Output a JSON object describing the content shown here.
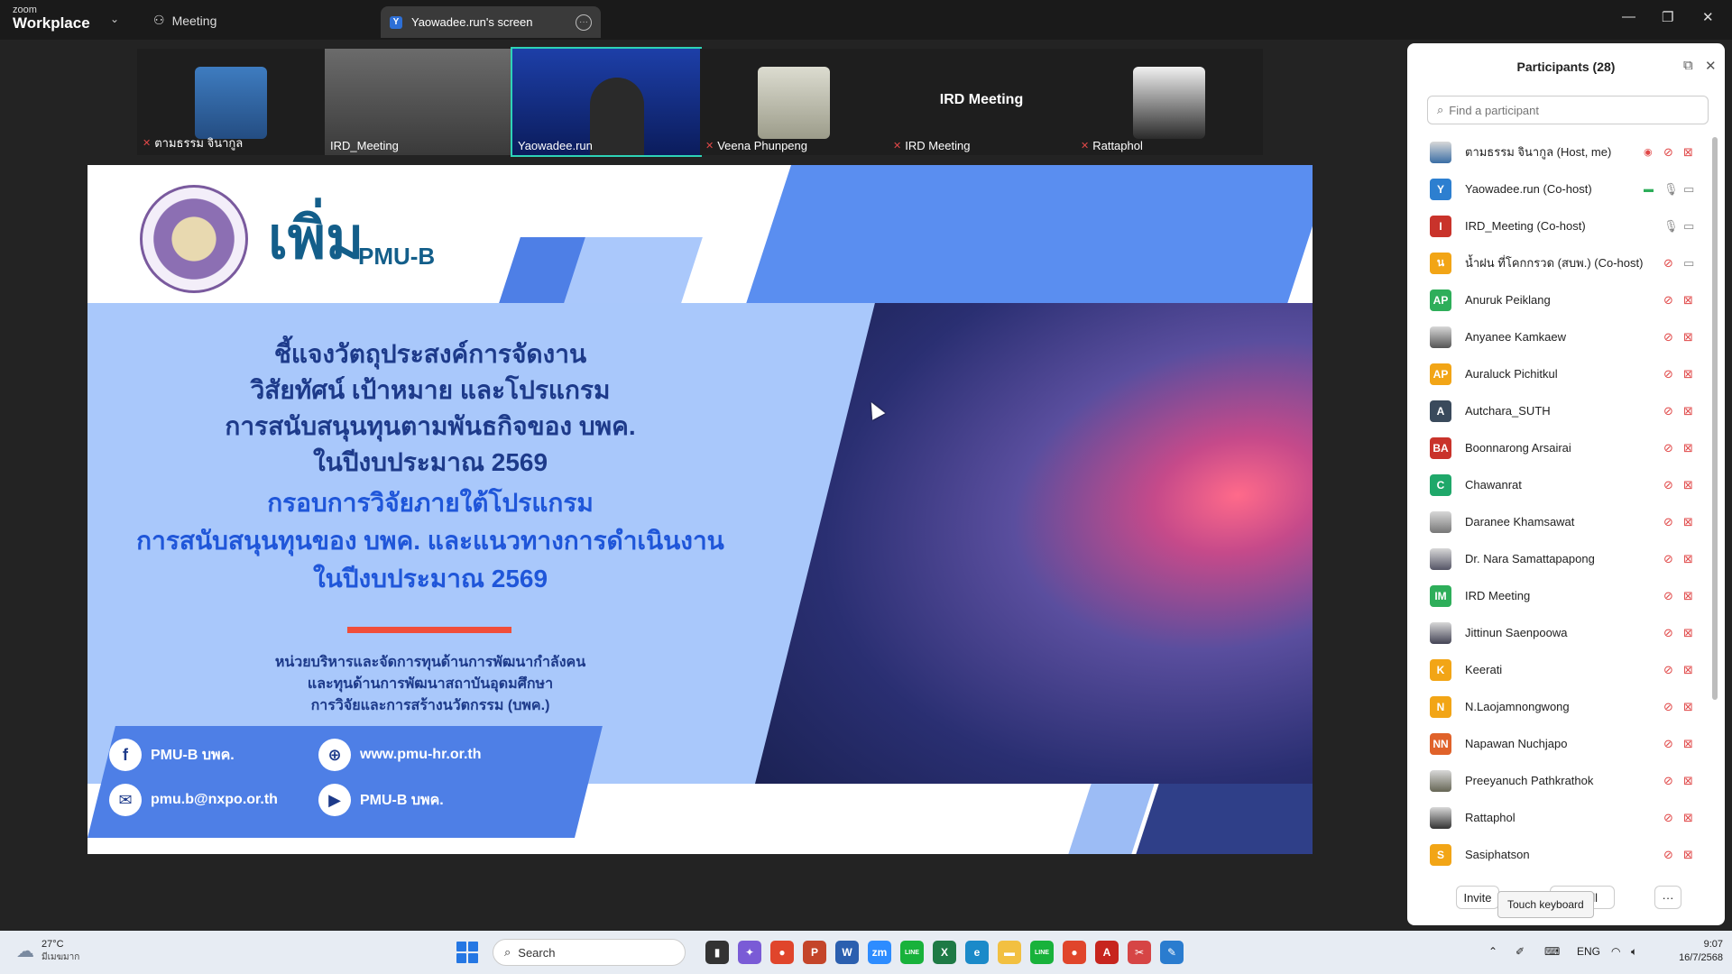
{
  "titlebar": {
    "brand_small": "zoom",
    "brand_big": "Workplace",
    "meeting_label": "Meeting",
    "tab_label": "Yaowadee.run's screen",
    "tab_icon_letter": "Y"
  },
  "thumbnails": [
    {
      "name": "ตามธรรม จินากูล",
      "muted": true
    },
    {
      "name": "IRD_Meeting",
      "muted": false
    },
    {
      "name": "Yaowadee.run",
      "muted": false
    },
    {
      "name": "Veena Phunpeng",
      "muted": true
    },
    {
      "name": "IRD Meeting",
      "muted": true,
      "tile_text": "IRD Meeting"
    },
    {
      "name": "Rattaphol",
      "muted": true
    }
  ],
  "slide": {
    "logo_text": "เพิ่ม",
    "logo_sub": "PMU-B",
    "title_lines_dark": [
      "ชี้แจงวัตถุประสงค์การจัดงาน",
      "วิสัยทัศน์ เป้าหมาย และโปรแกรม",
      "การสนับสนุนทุนตามพันธกิจของ บพค.",
      "ในปีงบประมาณ 2569"
    ],
    "title_lines_blue": [
      "กรอบการวิจัยภายใต้โปรแกรม",
      "การสนับสนุนทุนของ บพค. และแนวทางการดำเนินงาน",
      "ในปีงบประมาณ 2569"
    ],
    "org_lines": [
      "หน่วยบริหารและจัดการทุนด้านการพัฒนากำลังคน",
      "และทุนด้านการพัฒนาสถาบันอุดมศึกษา",
      "การวิจัยและการสร้างนวัตกรรม (บพค.)"
    ],
    "contacts": {
      "facebook": "PMU-B บพค.",
      "website": "www.pmu-hr.or.th",
      "email": "pmu.b@nxpo.or.th",
      "youtube": "PMU-B บพค."
    }
  },
  "participants": {
    "title": "Participants (28)",
    "search_placeholder": "Find a participant",
    "list": [
      {
        "name": "ตามธรรม จินากูล (Host, me)",
        "initials": "",
        "color": "#3a6ea5",
        "photo": true,
        "mic": "off",
        "cam": "off",
        "extra": "rec"
      },
      {
        "name": "Yaowadee.run (Co-host)",
        "initials": "Y",
        "color": "#2d7fd0",
        "mic": "on",
        "cam": "on",
        "extra": "share"
      },
      {
        "name": "IRD_Meeting (Co-host)",
        "initials": "I",
        "color": "#c9332b",
        "mic": "on",
        "cam": "on"
      },
      {
        "name": "น้ำฝน ที่โคกกรวด (สบพ.) (Co-host)",
        "initials": "น",
        "color": "#f2a516",
        "mic": "off",
        "cam": "on"
      },
      {
        "name": "Anuruk Peiklang",
        "initials": "AP",
        "color": "#2eae5a",
        "mic": "off",
        "cam": "off"
      },
      {
        "name": "Anyanee Kamkaew",
        "initials": "",
        "color": "#555",
        "photo": true,
        "mic": "off",
        "cam": "off"
      },
      {
        "name": "Auraluck Pichitkul",
        "initials": "AP",
        "color": "#f2a516",
        "mic": "off",
        "cam": "off"
      },
      {
        "name": "Autchara_SUTH",
        "initials": "A",
        "color": "#3a4a5c",
        "mic": "off",
        "cam": "off"
      },
      {
        "name": "Boonnarong Arsairai",
        "initials": "BA",
        "color": "#c9332b",
        "mic": "off",
        "cam": "off"
      },
      {
        "name": "Chawanrat",
        "initials": "C",
        "color": "#1fa86a",
        "mic": "off",
        "cam": "off"
      },
      {
        "name": "Daranee Khamsawat",
        "initials": "",
        "color": "#777",
        "photo": true,
        "mic": "off",
        "cam": "off"
      },
      {
        "name": "Dr. Nara Samattapapong",
        "initials": "",
        "color": "#556",
        "photo": true,
        "mic": "off",
        "cam": "off"
      },
      {
        "name": "IRD Meeting",
        "initials": "IM",
        "color": "#2eae5a",
        "mic": "off",
        "cam": "off"
      },
      {
        "name": "Jittinun Saenpoowa",
        "initials": "",
        "color": "#445",
        "photo": true,
        "mic": "off",
        "cam": "off"
      },
      {
        "name": "Keerati",
        "initials": "K",
        "color": "#f2a516",
        "mic": "off",
        "cam": "off"
      },
      {
        "name": "N.Laojamnongwong",
        "initials": "N",
        "color": "#f2a516",
        "mic": "off",
        "cam": "off"
      },
      {
        "name": "Napawan Nuchjapo",
        "initials": "NN",
        "color": "#e0622a",
        "mic": "off",
        "cam": "off"
      },
      {
        "name": "Preeyanuch Pathkrathok",
        "initials": "",
        "color": "#665",
        "photo": true,
        "mic": "off",
        "cam": "off"
      },
      {
        "name": "Rattaphol",
        "initials": "",
        "color": "#333",
        "photo": true,
        "mic": "off",
        "cam": "off"
      },
      {
        "name": "Sasiphatson",
        "initials": "S",
        "color": "#f2a516",
        "mic": "off",
        "cam": "off"
      }
    ],
    "invite_label": "Invite",
    "mute_all_fragment": "ll",
    "more_label": "···",
    "tooltip": "Touch keyboard"
  },
  "taskbar": {
    "temp": "27°C",
    "condition": "มีเมฆมาก",
    "search_placeholder": "Search",
    "lang": "ENG",
    "time": "9:07",
    "date": "16/7/2568",
    "apps": [
      {
        "name": "file-explorer-dark",
        "glyph": "▮",
        "color": "#333"
      },
      {
        "name": "copilot",
        "glyph": "✦",
        "color": "#7a5bd6"
      },
      {
        "name": "chrome",
        "glyph": "●",
        "color": "#e0452b"
      },
      {
        "name": "powerpoint",
        "glyph": "P",
        "color": "#c4452a"
      },
      {
        "name": "word",
        "glyph": "W",
        "color": "#2b5faf"
      },
      {
        "name": "zoom",
        "glyph": "zm",
        "color": "#2d8cff"
      },
      {
        "name": "line",
        "glyph": "LINE",
        "color": "#18b23b"
      },
      {
        "name": "excel",
        "glyph": "X",
        "color": "#1e7a45"
      },
      {
        "name": "edge",
        "glyph": "e",
        "color": "#1b8ac9"
      },
      {
        "name": "folder",
        "glyph": "▬",
        "color": "#f2c041"
      },
      {
        "name": "line2",
        "glyph": "LINE",
        "color": "#18b23b"
      },
      {
        "name": "chrome2",
        "glyph": "●",
        "color": "#e0452b"
      },
      {
        "name": "acrobat",
        "glyph": "A",
        "color": "#c7251e"
      },
      {
        "name": "snipping",
        "glyph": "✂",
        "color": "#d64545"
      },
      {
        "name": "paint",
        "glyph": "✎",
        "color": "#2a7ccf"
      }
    ]
  }
}
